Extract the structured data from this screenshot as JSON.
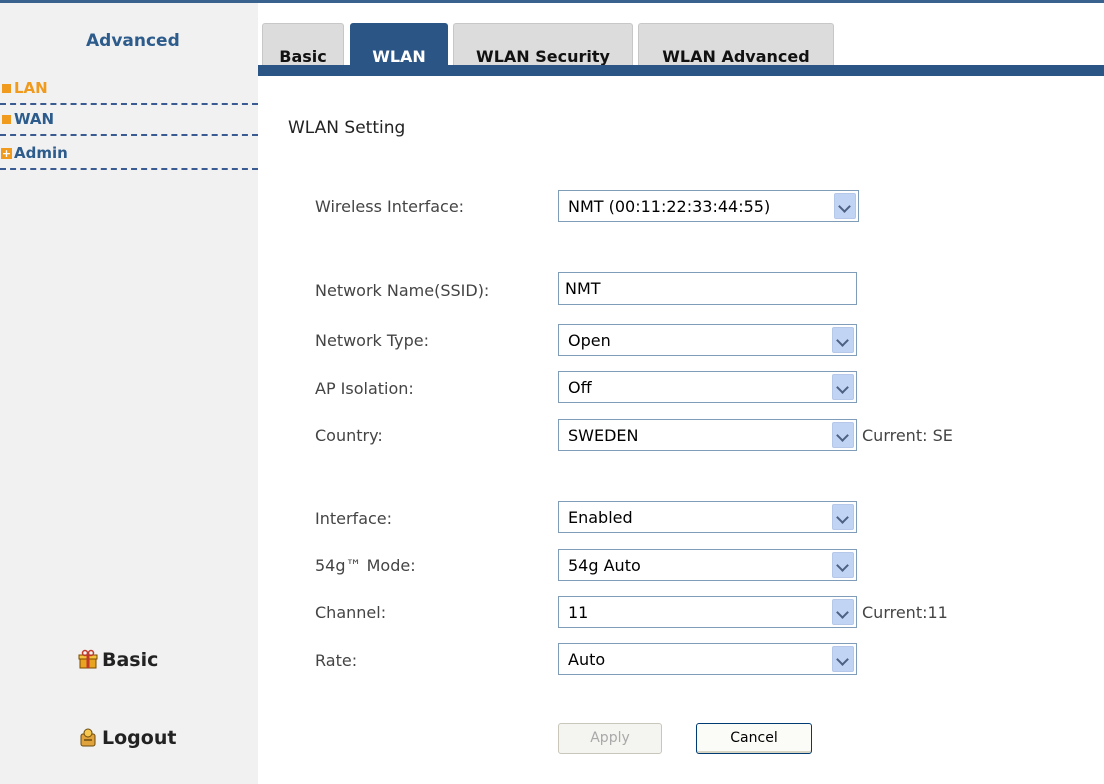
{
  "sidebar": {
    "title": "Advanced",
    "items": [
      {
        "label": "LAN",
        "active": true,
        "icon": "orange-square-icon"
      },
      {
        "label": "WAN",
        "active": false,
        "icon": "orange-square-icon"
      },
      {
        "label": "Admin",
        "active": false,
        "icon": "plus-expand-icon"
      }
    ],
    "basic_label": "Basic",
    "logout_label": "Logout",
    "accent_color": "#f09a1e",
    "link_color": "#2d5c8c"
  },
  "tabs": [
    {
      "label": "Basic",
      "active": false
    },
    {
      "label": "WLAN",
      "active": true
    },
    {
      "label": "WLAN Security",
      "active": false
    },
    {
      "label": "WLAN Advanced",
      "active": false
    }
  ],
  "tab_active_color": "#2b5584",
  "section": {
    "title": "WLAN Setting"
  },
  "form": {
    "wireless_interface": {
      "label": "Wireless Interface:",
      "value": "NMT (00:11:22:33:44:55)"
    },
    "ssid": {
      "label": "Network Name(SSID):",
      "value": "NMT"
    },
    "network_type": {
      "label": "Network Type:",
      "value": "Open"
    },
    "ap_isolation": {
      "label": "AP Isolation:",
      "value": "Off"
    },
    "country": {
      "label": "Country:",
      "value": "SWEDEN",
      "current": "Current: SE"
    },
    "interface": {
      "label": "Interface:",
      "value": "Enabled"
    },
    "mode_54g": {
      "label": "54g™ Mode:",
      "value": "54g Auto"
    },
    "channel": {
      "label": "Channel:",
      "value": "11",
      "current": "Current:11"
    },
    "rate": {
      "label": "Rate:",
      "value": "Auto"
    }
  },
  "buttons": {
    "apply": "Apply",
    "cancel": "Cancel",
    "apply_enabled": false
  }
}
